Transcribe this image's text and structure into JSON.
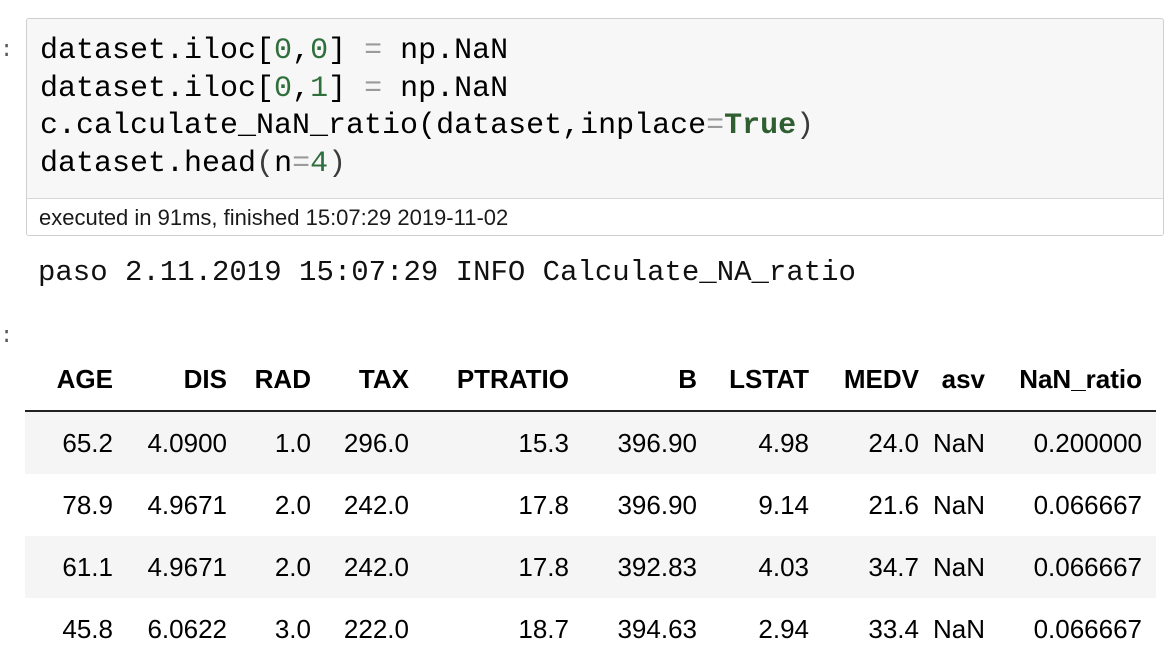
{
  "prompts": {
    "input_marker": ":",
    "output_marker": ":"
  },
  "code_cell": {
    "lines": [
      [
        {
          "t": "dataset.iloc[",
          "c": "plain"
        },
        {
          "t": "0",
          "c": "num"
        },
        {
          "t": ",",
          "c": "plain"
        },
        {
          "t": "0",
          "c": "num"
        },
        {
          "t": "] ",
          "c": "plain"
        },
        {
          "t": "=",
          "c": "op"
        },
        {
          "t": " np.NaN",
          "c": "plain"
        }
      ],
      [
        {
          "t": "dataset.iloc[",
          "c": "plain"
        },
        {
          "t": "0",
          "c": "num"
        },
        {
          "t": ",",
          "c": "plain"
        },
        {
          "t": "1",
          "c": "num"
        },
        {
          "t": "] ",
          "c": "plain"
        },
        {
          "t": "=",
          "c": "op"
        },
        {
          "t": " np.NaN",
          "c": "plain"
        }
      ],
      [
        {
          "t": "c.calculate_NaN_ratio(dataset,inplace",
          "c": "plain"
        },
        {
          "t": "=",
          "c": "op"
        },
        {
          "t": "True",
          "c": "kw"
        },
        {
          "t": ")",
          "c": "paren"
        }
      ],
      [
        {
          "t": "dataset.head",
          "c": "plain"
        },
        {
          "t": "(",
          "c": "paren"
        },
        {
          "t": "n",
          "c": "plain"
        },
        {
          "t": "=",
          "c": "op"
        },
        {
          "t": "4",
          "c": "num"
        },
        {
          "t": ")",
          "c": "paren"
        }
      ]
    ],
    "execution_info": "executed in 91ms, finished 15:07:29 2019-11-02"
  },
  "log_output": "paso 2.11.2019 15:07:29 INFO Calculate_NA_ratio",
  "dataframe": {
    "columns": [
      "AGE",
      "DIS",
      "RAD",
      "TAX",
      "PTRATIO",
      "B",
      "LSTAT",
      "MEDV",
      "asv",
      "NaN_ratio"
    ],
    "rows": [
      [
        "65.2",
        "4.0900",
        "1.0",
        "296.0",
        "15.3",
        "396.90",
        "4.98",
        "24.0",
        "NaN",
        "0.200000"
      ],
      [
        "78.9",
        "4.9671",
        "2.0",
        "242.0",
        "17.8",
        "396.90",
        "9.14",
        "21.6",
        "NaN",
        "0.066667"
      ],
      [
        "61.1",
        "4.9671",
        "2.0",
        "242.0",
        "17.8",
        "392.83",
        "4.03",
        "34.7",
        "NaN",
        "0.066667"
      ],
      [
        "45.8",
        "6.0622",
        "3.0",
        "222.0",
        "18.7",
        "394.63",
        "2.94",
        "33.4",
        "NaN",
        "0.066667"
      ]
    ]
  }
}
